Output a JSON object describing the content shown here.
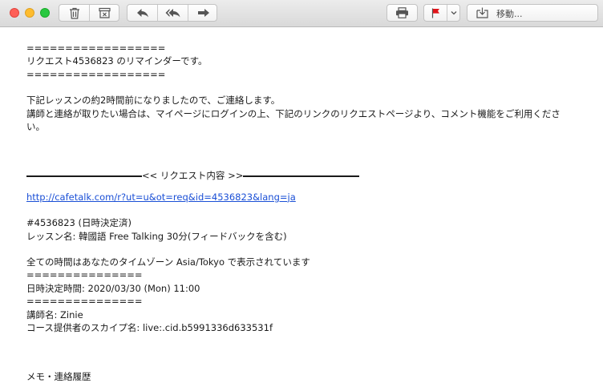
{
  "toolbar": {
    "move_label": "移動...",
    "icons": [
      "trash-icon",
      "archive-icon",
      "reply-icon",
      "reply-all-icon",
      "forward-icon",
      "print-icon",
      "flag-icon",
      "chevron-down-icon",
      "move-to-folder-icon"
    ],
    "flag_color": "#e0141a"
  },
  "email": {
    "sep1": "==================",
    "reminder": "リクエスト4536823 のリマインダーです。",
    "sep2": "==================",
    "para1": "下記レッスンの約2時間前になりましたので、ご連絡します。",
    "para2": "講師と連絡が取りたい場合は、マイページにログインの上、下記のリンクのリクエストページより、コメント機能をご利用くださ",
    "para2_cont": "い。",
    "section_header": "<< リクエスト内容 >>",
    "link": "http://cafetalk.com/r?ut=u&ot=req&id=4536823&lang=ja",
    "request_id": "#4536823 (日時決定済)",
    "lesson_name": "レッスン名: 韓國語 Free Talking 30分(フィードバックを含む)",
    "timezone_note": "全ての時間はあなたのタイムゾーン Asia/Tokyo で表示されています",
    "sep3": "===============",
    "datetime": "日時決定時間: 2020/03/30 (Mon) 11:00",
    "sep4": "===============",
    "tutor": "講師名: Zinie",
    "skype": "コース提供者のスカイプ名: live:.cid.b5991336d633531f",
    "footer_partial": "メモ・連絡履歴"
  }
}
